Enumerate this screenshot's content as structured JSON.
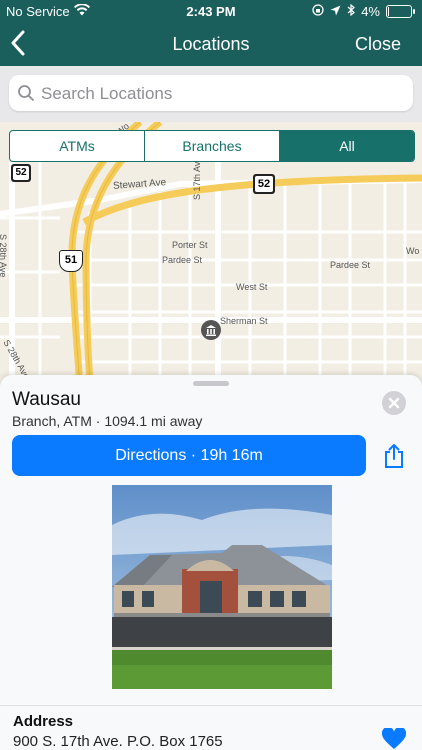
{
  "status_bar": {
    "carrier": "No Service",
    "time": "2:43 PM",
    "battery": "4%",
    "battery_level": 0.04
  },
  "nav": {
    "title": "Locations",
    "close_label": "Close"
  },
  "search": {
    "placeholder": "Search Locations",
    "value": ""
  },
  "filter": {
    "options": [
      "ATMs",
      "Branches",
      "All"
    ],
    "selected": "All"
  },
  "map": {
    "street_labels": [
      "Stewart Ave",
      "Porter St",
      "Pardee St",
      "Pardee St",
      "West St",
      "Sherman St",
      "S 17th Ave",
      "S 28th Ave",
      "S 28th Ave",
      "Wo",
      "Wo"
    ],
    "route_shields": [
      "52",
      "52",
      "51"
    ]
  },
  "location": {
    "name": "Wausau",
    "subtitle": "Branch, ATM · 1094.1 mi away",
    "directions_label": "Directions · 19h 16m",
    "address_label": "Address",
    "address_value": "900 S. 17th Ave.  P.O. Box 1765"
  },
  "colors": {
    "header": "#1a5f5c",
    "segment_accent": "#17706a",
    "directions_button": "#0a7aff"
  }
}
